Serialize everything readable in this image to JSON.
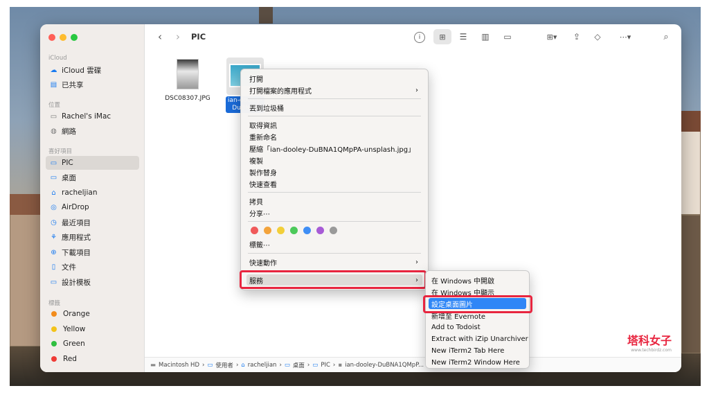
{
  "window": {
    "title": "PIC"
  },
  "sidebar": {
    "sections": {
      "icloud": "iCloud",
      "locations": "位置",
      "favorites": "喜好項目",
      "tags": "標籤"
    },
    "icloud_items": [
      "iCloud 雲碟",
      "已共享"
    ],
    "location_items": [
      "Rachel's iMac",
      "網路"
    ],
    "favorite_items": [
      "PIC",
      "桌面",
      "racheljian",
      "AirDrop",
      "最近項目",
      "應用程式",
      "下載項目",
      "文件",
      "設計模板"
    ],
    "tag_items": [
      {
        "label": "Orange",
        "color": "#f28c1c"
      },
      {
        "label": "Yellow",
        "color": "#f3c31a"
      },
      {
        "label": "Green",
        "color": "#2fbf40"
      },
      {
        "label": "Red",
        "color": "#ef3b36"
      }
    ]
  },
  "files": [
    {
      "name": "DSC08307.JPG"
    },
    {
      "name": "ian-dooley-",
      "name2": "DuBNA1"
    }
  ],
  "pathbar": [
    "Macintosh HD",
    "使用者",
    "racheljian",
    "桌面",
    "PIC",
    "ian-dooley-DuBNA1QMpP..."
  ],
  "context_menu": {
    "open": "打開",
    "open_with": "打開檔案的應用程式",
    "trash": "丟到垃圾桶",
    "get_info": "取得資訊",
    "rename": "重新命名",
    "compress": "壓縮「ian-dooley-DuBNA1QMpPA-unsplash.jpg」",
    "duplicate": "複製",
    "alias": "製作替身",
    "quicklook": "快速查看",
    "copy": "拷貝",
    "share": "分享⋯",
    "tag_colors": [
      "#f05a5a",
      "#f3a33b",
      "#f2cf3a",
      "#4cc95a",
      "#3f8ef5",
      "#a75bd6",
      "#9a9a9a"
    ],
    "tags": "標籤⋯",
    "quick_actions": "快速動作",
    "services": "服務"
  },
  "services_menu": [
    "在 Windows 中開啟",
    "在 Windows 中顯示",
    "設定桌面圖片",
    "新增至 Evernote",
    "Add to Todoist",
    "Extract with iZip Unarchiver",
    "New iTerm2 Tab Here",
    "New iTerm2 Window Here"
  ],
  "watermark": {
    "text": "塔科女子",
    "sub": "www.techbirdz.com"
  }
}
